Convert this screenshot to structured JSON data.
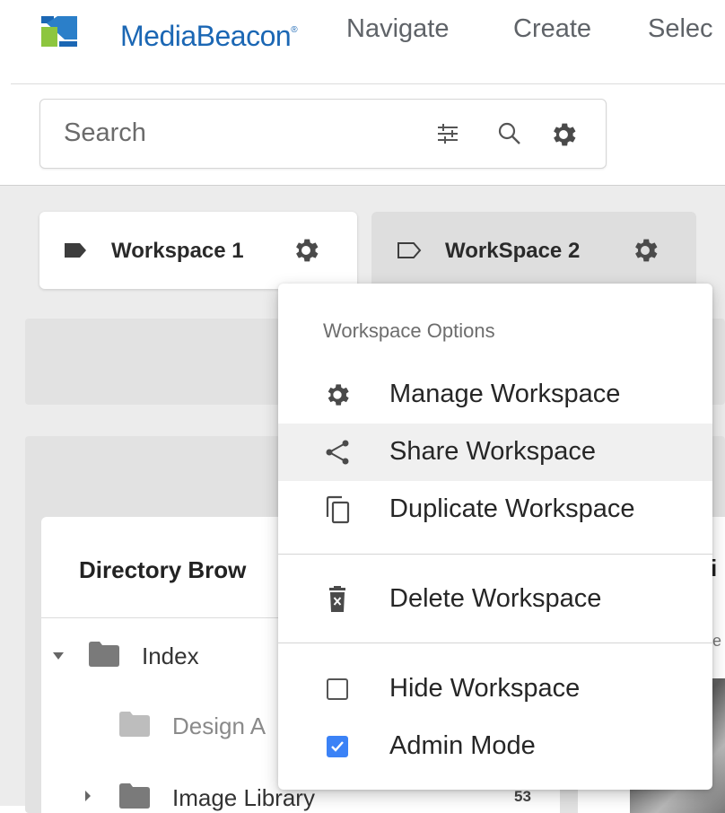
{
  "app": {
    "brand": "MediaBeacon",
    "brand_mark": "®",
    "accent": "#1b67b4"
  },
  "nav": {
    "items": [
      {
        "label": "Navigate"
      },
      {
        "label": "Create"
      },
      {
        "label": "Selec"
      }
    ]
  },
  "search": {
    "placeholder": "Search",
    "value": ""
  },
  "workspaces": [
    {
      "label": "Workspace 1",
      "icon": "filled-tag-icon",
      "active": true
    },
    {
      "label": "WorkSpace 2",
      "icon": "outline-tag-icon",
      "active": false
    }
  ],
  "directory": {
    "title": "Directory Brow",
    "items": [
      {
        "label": "Index",
        "expanded": true
      },
      {
        "label": "Design A",
        "dimmed": true
      },
      {
        "label": "Image Library",
        "count": "53"
      }
    ]
  },
  "right_panel": {
    "title_fragment": "i",
    "sub_fragment": "e"
  },
  "menu": {
    "header": "Workspace Options",
    "items": [
      {
        "label": "Manage Workspace",
        "icon": "gear-icon"
      },
      {
        "label": "Share Workspace",
        "icon": "share-icon",
        "highlighted": true
      },
      {
        "label": "Duplicate Workspace",
        "icon": "copy-icon"
      },
      {
        "label": "Delete Workspace",
        "icon": "trash-icon"
      },
      {
        "label": "Hide Workspace",
        "icon": "checkbox-icon",
        "checked": false
      },
      {
        "label": "Admin Mode",
        "icon": "checkbox-icon",
        "checked": true
      }
    ]
  }
}
